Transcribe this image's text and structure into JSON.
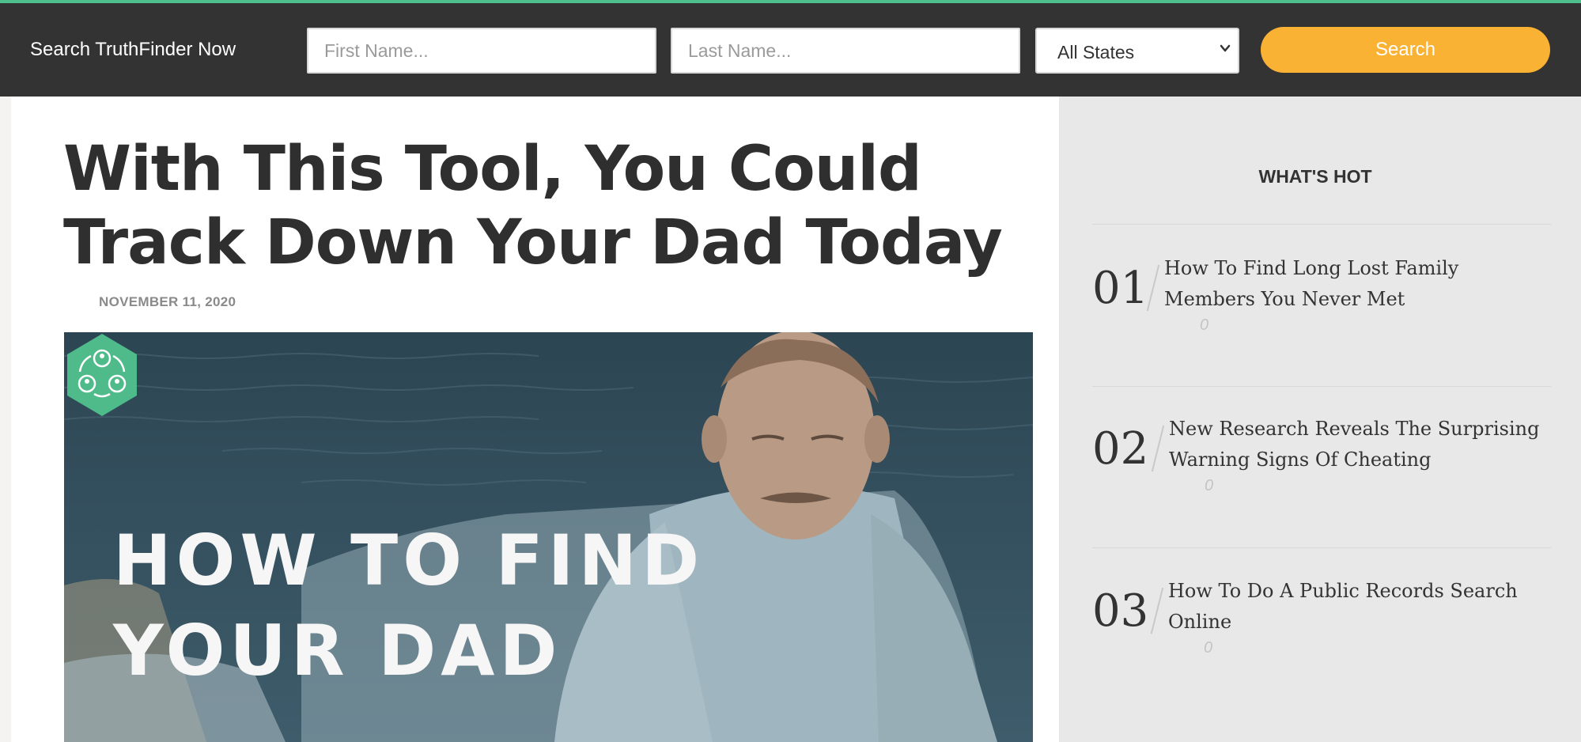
{
  "search": {
    "label": "Search TruthFinder Now",
    "first_name_placeholder": "First Name...",
    "last_name_placeholder": "Last Name...",
    "state_selected": "All States",
    "button_label": "Search"
  },
  "article": {
    "title": "With This Tool, You Could Track Down Your Dad Today",
    "date": "NOVEMBER 11, 2020",
    "hero_text_line1": "HOW TO FIND",
    "hero_text_line2": "YOUR DAD"
  },
  "sidebar": {
    "title": "WHAT'S HOT",
    "items": [
      {
        "number": "01",
        "title": "How To Find Long Lost Family Members You Never Met",
        "count": "0"
      },
      {
        "number": "02",
        "title": "New Research Reveals The Surprising Warning Signs Of Cheating",
        "count": "0"
      },
      {
        "number": "03",
        "title": "How To Do A Public Records Search Online",
        "count": "0"
      }
    ]
  },
  "colors": {
    "accent_line": "#4fc08d",
    "header_bg": "#333333",
    "search_button": "#f9b233",
    "sidebar_bg": "#e8e8e9",
    "logo_green": "#4fba8a"
  },
  "icons": {
    "select_caret": "chevron-down-icon",
    "hero_logo": "people-cycle-hexagon-icon"
  }
}
